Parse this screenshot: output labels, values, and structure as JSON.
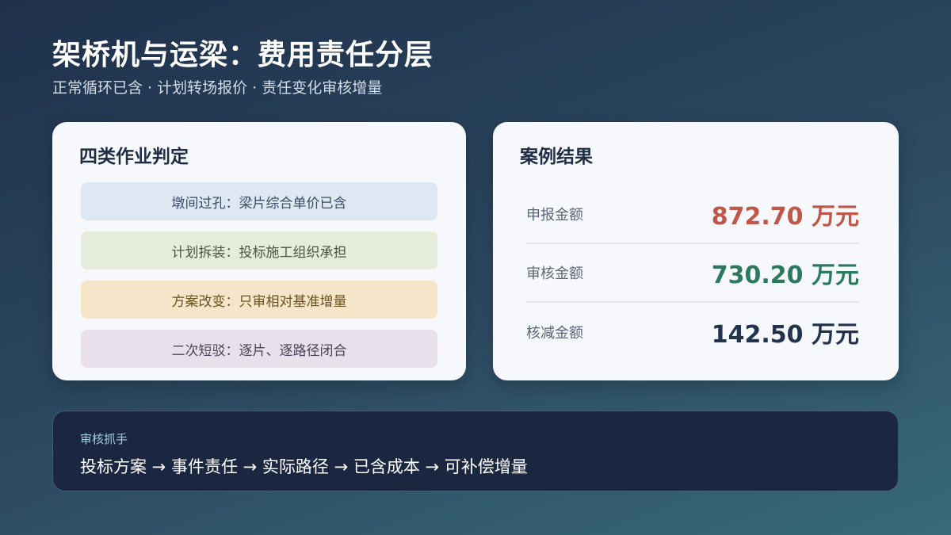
{
  "header": {
    "title": "架桥机与运梁：费用责任分层",
    "subtitle": "正常循环已含 · 计划转场报价 · 责任变化审核增量"
  },
  "left_card": {
    "heading": "四类作业判定",
    "rules": [
      "墩间过孔：梁片综合单价已含",
      "计划拆装：投标施工组织承担",
      "方案改变：只审相对基准增量",
      "二次短驳：逐片、逐路径闭合"
    ]
  },
  "right_card": {
    "heading": "案例结果",
    "rows": [
      {
        "label": "申报金额",
        "value": "872.70 万元"
      },
      {
        "label": "审核金额",
        "value": "730.20 万元"
      },
      {
        "label": "核减金额",
        "value": "142.50 万元"
      }
    ]
  },
  "banner": {
    "label": "审核抓手",
    "text": "投标方案 → 事件责任 → 实际路径 → 已含成本 → 可补偿增量"
  },
  "colors": {
    "declared": "#c0574a",
    "approved": "#2b7a5f",
    "reduced": "#22334d"
  }
}
